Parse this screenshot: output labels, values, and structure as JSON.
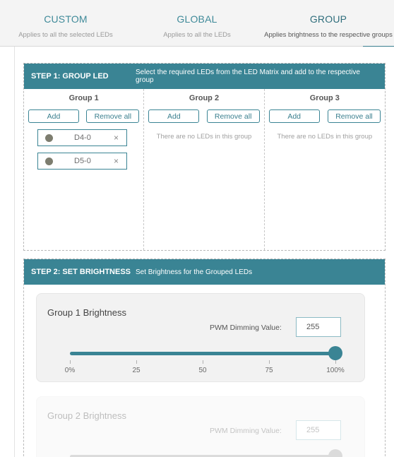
{
  "tabs": [
    {
      "title": "CUSTOM",
      "subtitle": "Applies to all the selected LEDs"
    },
    {
      "title": "GLOBAL",
      "subtitle": "Applies to all the LEDs"
    },
    {
      "title": "GROUP",
      "subtitle": "Applies brightness to the respective groups"
    }
  ],
  "active_tab": "GROUP",
  "step1": {
    "title": "STEP 1: GROUP LED",
    "description": "Select the required LEDs from the LED Matrix and add to the respective group",
    "groups": [
      {
        "name": "Group 1",
        "add_label": "Add",
        "remove_label": "Remove all",
        "leds": [
          "D4-0",
          "D5-0"
        ],
        "empty_text": ""
      },
      {
        "name": "Group 2",
        "add_label": "Add",
        "remove_label": "Remove all",
        "leds": [],
        "empty_text": "There are no LEDs in this group"
      },
      {
        "name": "Group 3",
        "add_label": "Add",
        "remove_label": "Remove all",
        "leds": [],
        "empty_text": "There are no LEDs in this group"
      }
    ],
    "remove_icon": "×"
  },
  "step2": {
    "title": "STEP 2: SET BRIGHTNESS",
    "description": "Set Brightness for the Grouped LEDs",
    "brightness": [
      {
        "title": "Group 1 Brightness",
        "pwm_label": "PWM Dimming Value:",
        "pwm_value": "255",
        "slider_percent": 100,
        "ticks": [
          "0%",
          "25",
          "50",
          "75",
          "100%"
        ]
      },
      {
        "title": "Group 2 Brightness",
        "pwm_label": "PWM Dimming Value:",
        "pwm_value": "255",
        "slider_percent": 100
      }
    ]
  },
  "colors": {
    "accent": "#3a8494",
    "tab_text": "#3f8a99"
  }
}
